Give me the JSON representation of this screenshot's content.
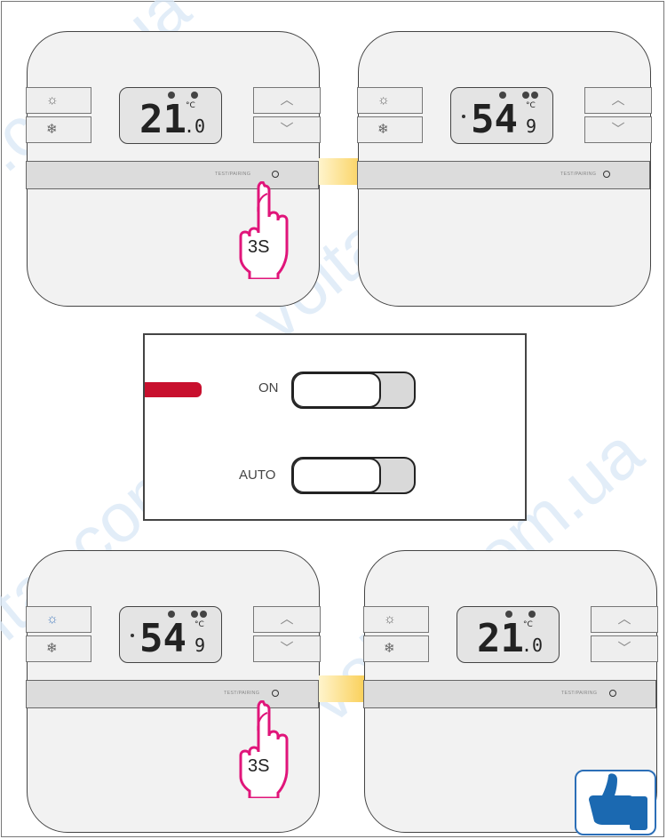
{
  "watermark_text": "voltar.com.ua",
  "test_pairing_label": "TEST/PAIRING",
  "up_arrow": "︿",
  "down_arrow": "﹀",
  "heat_icon": "☼",
  "cool_icon": "❄",
  "press_duration": "3S",
  "display_temp": {
    "main": "21",
    "decimal": ".0",
    "unit": "°C"
  },
  "display_code": {
    "main": "54",
    "decimal": "9",
    "unit": "°C"
  },
  "switch_panel": {
    "on_label": "ON",
    "auto_label": "AUTO"
  },
  "colors": {
    "hand": "#e0157a",
    "arrow": "#f6b400",
    "red_marker": "#c8102e",
    "thumb": "#1b69b1"
  }
}
